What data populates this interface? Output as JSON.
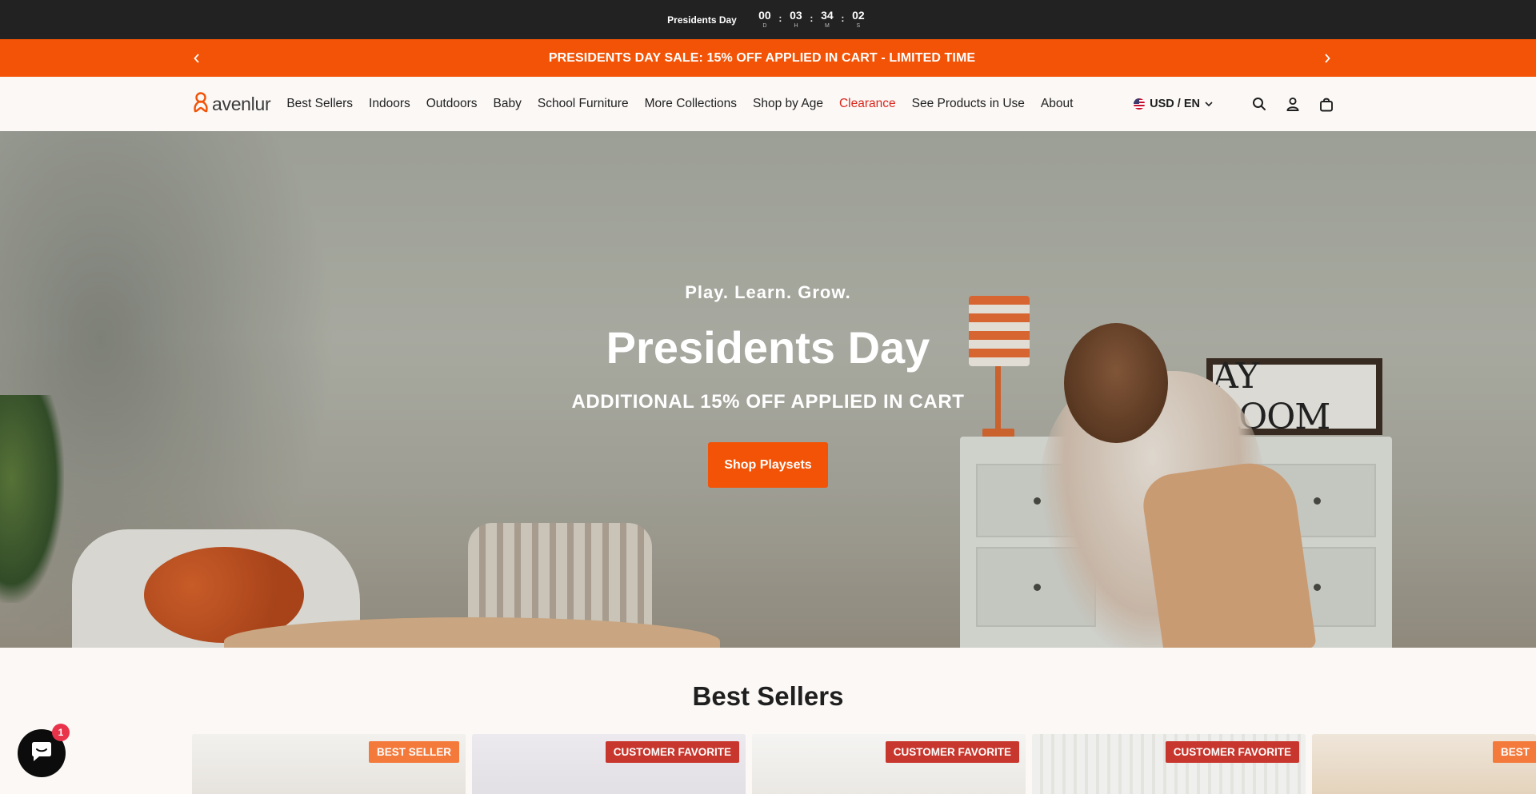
{
  "countdown": {
    "label": "Presidents Day",
    "units": [
      {
        "value": "00",
        "unit": "D"
      },
      {
        "value": "03",
        "unit": "H"
      },
      {
        "value": "34",
        "unit": "M"
      },
      {
        "value": "02",
        "unit": "S"
      }
    ],
    "separator": ":"
  },
  "promo": {
    "text": "PRESIDENTS DAY SALE: 15% OFF APPLIED IN CART - LIMITED TIME",
    "prev_icon": "chevron-left-icon",
    "next_icon": "chevron-right-icon"
  },
  "header": {
    "logo_text": "avenlur",
    "nav": [
      {
        "label": "Best Sellers"
      },
      {
        "label": "Indoors"
      },
      {
        "label": "Outdoors"
      },
      {
        "label": "Baby"
      },
      {
        "label": "School Furniture"
      },
      {
        "label": "More Collections"
      },
      {
        "label": "Shop by Age"
      },
      {
        "label": "Clearance",
        "color": "#d9261c"
      },
      {
        "label": "See Products in Use"
      },
      {
        "label": "About"
      }
    ],
    "locale": "USD / EN",
    "icons": [
      "search-icon",
      "account-icon",
      "cart-icon"
    ]
  },
  "hero": {
    "kicker": "Play. Learn. Grow.",
    "title": "Presidents Day",
    "subtitle": "ADDITIONAL 15% OFF APPLIED IN CART",
    "cta": "Shop Playsets",
    "sign_text": "AY ROOM"
  },
  "best_sellers": {
    "title": "Best Sellers",
    "cards": [
      {
        "badge": "BEST SELLER",
        "badge_color": "#f47a3c"
      },
      {
        "badge": "CUSTOMER FAVORITE",
        "badge_color": "#c8372d"
      },
      {
        "badge": "CUSTOMER FAVORITE",
        "badge_color": "#c8372d"
      },
      {
        "badge": "CUSTOMER FAVORITE",
        "badge_color": "#c8372d"
      },
      {
        "badge": "BEST",
        "badge_color": "#f47a3c"
      }
    ]
  },
  "chat": {
    "icon": "chat-icon",
    "badge_count": "1"
  },
  "colors": {
    "accent": "#f25306",
    "dark": "#222222",
    "sale": "#d9261c"
  }
}
